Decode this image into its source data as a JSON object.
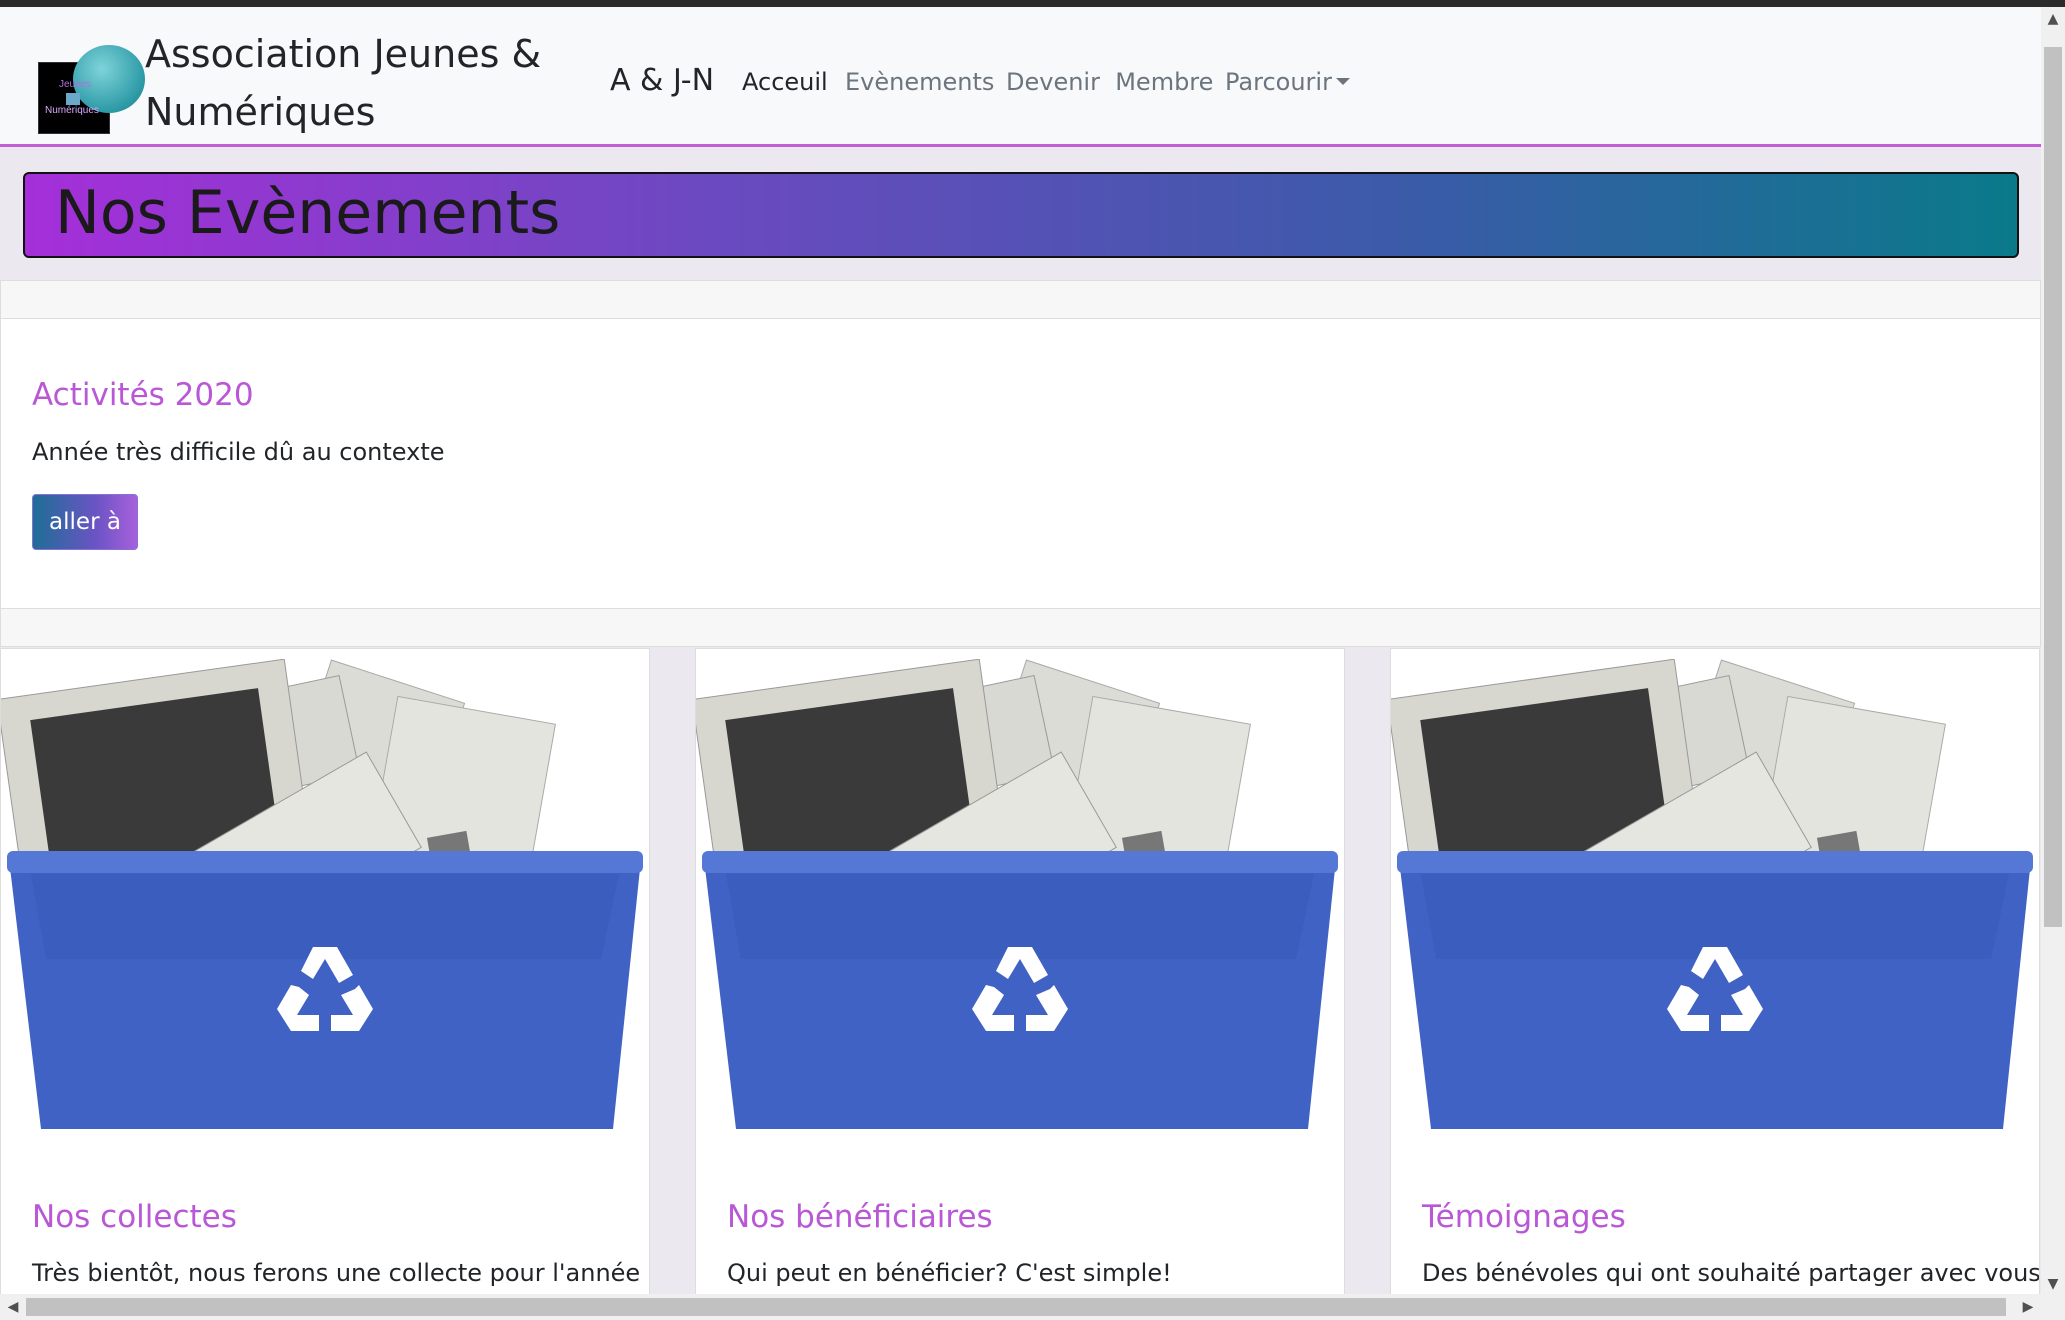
{
  "brand": {
    "name": "Association Jeunes & Numériques",
    "short": "A & J-N",
    "logo_text_top": "Jeunes",
    "logo_text_bottom": "Numériques"
  },
  "nav": {
    "items": [
      {
        "label": "Acceuil",
        "active": true
      },
      {
        "label": "Evènements",
        "active": false
      },
      {
        "label": "Devenir  Membre",
        "active": false
      },
      {
        "label": "Parcourir",
        "active": false,
        "dropdown": true
      }
    ]
  },
  "banner": {
    "title": "Nos Evènements"
  },
  "featured": {
    "title": "Activités 2020",
    "text": "Année très difficile dû au contexte",
    "button": "aller à"
  },
  "cards": [
    {
      "title": "Nos collectes",
      "text": "Très bientôt, nous ferons une collecte pour l'année",
      "image": "recycling-bin-computers"
    },
    {
      "title": "Nos bénéficiaires",
      "text": "Qui peut en bénéficier? C'est simple!",
      "image": "recycling-bin-computers"
    },
    {
      "title": "Témoignages",
      "text": "Des bénévoles qui ont souhaité partager avec vous,",
      "image": "recycling-bin-computers"
    }
  ],
  "colors": {
    "accent": "#b957d6",
    "banner_start": "#a52fd9",
    "banner_end": "#0a7a8a",
    "bin_blue": "#3f62c4"
  }
}
